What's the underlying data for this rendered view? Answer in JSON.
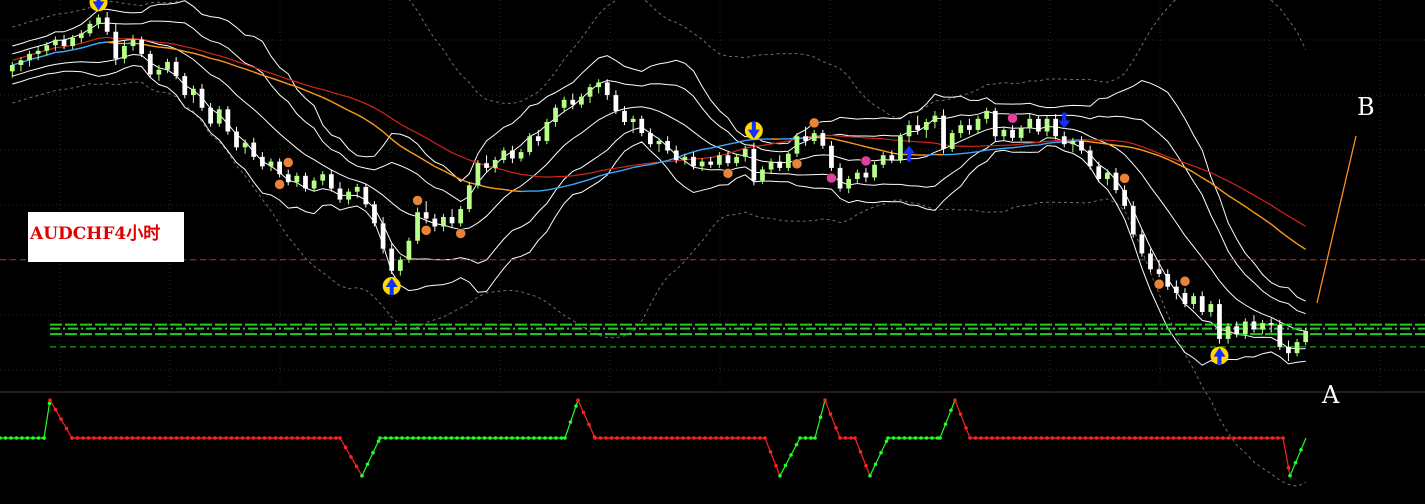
{
  "label": "AUDCHF4小时",
  "annotations": {
    "a": "A",
    "b": "B"
  },
  "colors": {
    "background": "#000000",
    "grid": "#26301f",
    "candle_bull": "#b8ff8a",
    "candle_bear": "#ffffff",
    "band": "#ffffff",
    "outer_band": "#6e6e6e",
    "ma_cyan": "#3aa8ff",
    "ma_orange": "#ff9a1a",
    "ma_red": "#d2261a",
    "support_line": "#22cc22",
    "resistance_line": "#cc2a2a",
    "trend_line": "#ff8c1a",
    "ind_up": "#22ff22",
    "ind_down": "#ff2222"
  },
  "chart_data": {
    "type": "candlestick",
    "symbol": "AUDCHF",
    "timeframe": "H4",
    "y_range": [
      0.73,
      0.778
    ],
    "ohlc": [
      [
        0.77,
        0.7712,
        0.7692,
        0.7708
      ],
      [
        0.7708,
        0.7718,
        0.77,
        0.7714
      ],
      [
        0.7714,
        0.7726,
        0.7706,
        0.7722
      ],
      [
        0.7722,
        0.7731,
        0.7714,
        0.7726
      ],
      [
        0.7726,
        0.7737,
        0.772,
        0.7733
      ],
      [
        0.7733,
        0.7744,
        0.7726,
        0.774
      ],
      [
        0.774,
        0.7746,
        0.7728,
        0.7732
      ],
      [
        0.7732,
        0.7746,
        0.7728,
        0.7742
      ],
      [
        0.7742,
        0.7752,
        0.7736,
        0.7748
      ],
      [
        0.7748,
        0.7764,
        0.7744,
        0.776
      ],
      [
        0.776,
        0.7772,
        0.7754,
        0.7768
      ],
      [
        0.7768,
        0.7775,
        0.7746,
        0.775
      ],
      [
        0.775,
        0.776,
        0.7708,
        0.7716
      ],
      [
        0.7716,
        0.7738,
        0.771,
        0.7732
      ],
      [
        0.7732,
        0.7746,
        0.7726,
        0.774
      ],
      [
        0.774,
        0.7744,
        0.7718,
        0.7722
      ],
      [
        0.7722,
        0.7726,
        0.7692,
        0.7696
      ],
      [
        0.7696,
        0.7708,
        0.7688,
        0.7702
      ],
      [
        0.7702,
        0.7716,
        0.7698,
        0.7712
      ],
      [
        0.7712,
        0.7718,
        0.769,
        0.7694
      ],
      [
        0.7694,
        0.7698,
        0.7666,
        0.767
      ],
      [
        0.767,
        0.7682,
        0.766,
        0.7678
      ],
      [
        0.7678,
        0.7684,
        0.765,
        0.7654
      ],
      [
        0.7654,
        0.766,
        0.763,
        0.7634
      ],
      [
        0.7634,
        0.7656,
        0.763,
        0.7652
      ],
      [
        0.7652,
        0.7656,
        0.762,
        0.7624
      ],
      [
        0.7624,
        0.763,
        0.76,
        0.7604
      ],
      [
        0.7604,
        0.7614,
        0.7596,
        0.761
      ],
      [
        0.761,
        0.7616,
        0.7588,
        0.7592
      ],
      [
        0.7592,
        0.7598,
        0.7576,
        0.758
      ],
      [
        0.758,
        0.759,
        0.7574,
        0.7586
      ],
      [
        0.7586,
        0.759,
        0.7566,
        0.757
      ],
      [
        0.757,
        0.7576,
        0.7556,
        0.756
      ],
      [
        0.756,
        0.7572,
        0.7554,
        0.7568
      ],
      [
        0.7568,
        0.7572,
        0.7548,
        0.7552
      ],
      [
        0.7552,
        0.7566,
        0.7548,
        0.7562
      ],
      [
        0.7562,
        0.7574,
        0.7556,
        0.757
      ],
      [
        0.757,
        0.7576,
        0.7548,
        0.7552
      ],
      [
        0.7552,
        0.756,
        0.7534,
        0.7538
      ],
      [
        0.7538,
        0.7552,
        0.7532,
        0.7548
      ],
      [
        0.7548,
        0.7558,
        0.754,
        0.7554
      ],
      [
        0.7554,
        0.7558,
        0.7528,
        0.7532
      ],
      [
        0.7532,
        0.7536,
        0.7504,
        0.7508
      ],
      [
        0.7508,
        0.7516,
        0.747,
        0.7476
      ],
      [
        0.7476,
        0.7482,
        0.7444,
        0.7448
      ],
      [
        0.7448,
        0.7466,
        0.7442,
        0.7462
      ],
      [
        0.7462,
        0.749,
        0.7458,
        0.7486
      ],
      [
        0.7486,
        0.7528,
        0.7482,
        0.7522
      ],
      [
        0.7522,
        0.7536,
        0.7508,
        0.7514
      ],
      [
        0.7514,
        0.752,
        0.7498,
        0.7504
      ],
      [
        0.7504,
        0.752,
        0.7498,
        0.7516
      ],
      [
        0.7516,
        0.7526,
        0.7502,
        0.7508
      ],
      [
        0.7508,
        0.753,
        0.7504,
        0.7526
      ],
      [
        0.7526,
        0.756,
        0.7522,
        0.7556
      ],
      [
        0.7556,
        0.7588,
        0.7552,
        0.7584
      ],
      [
        0.7584,
        0.7594,
        0.7572,
        0.7578
      ],
      [
        0.7578,
        0.7592,
        0.7572,
        0.7588
      ],
      [
        0.7588,
        0.7604,
        0.7584,
        0.76
      ],
      [
        0.76,
        0.7606,
        0.7584,
        0.759
      ],
      [
        0.759,
        0.7602,
        0.7586,
        0.7598
      ],
      [
        0.7598,
        0.7622,
        0.7594,
        0.7618
      ],
      [
        0.7618,
        0.7626,
        0.7606,
        0.7612
      ],
      [
        0.7612,
        0.764,
        0.7608,
        0.7636
      ],
      [
        0.7636,
        0.7658,
        0.763,
        0.7654
      ],
      [
        0.7654,
        0.7668,
        0.7648,
        0.7664
      ],
      [
        0.7664,
        0.7672,
        0.7652,
        0.7658
      ],
      [
        0.7658,
        0.7672,
        0.7654,
        0.7668
      ],
      [
        0.7668,
        0.7684,
        0.766,
        0.768
      ],
      [
        0.768,
        0.769,
        0.7672,
        0.7686
      ],
      [
        0.7686,
        0.769,
        0.7664,
        0.767
      ],
      [
        0.767,
        0.7676,
        0.7646,
        0.765
      ],
      [
        0.765,
        0.7656,
        0.7632,
        0.7636
      ],
      [
        0.7636,
        0.7644,
        0.7622,
        0.764
      ],
      [
        0.764,
        0.7644,
        0.7618,
        0.7622
      ],
      [
        0.7622,
        0.7628,
        0.7604,
        0.7608
      ],
      [
        0.7608,
        0.7616,
        0.7598,
        0.7612
      ],
      [
        0.7612,
        0.7618,
        0.7596,
        0.76
      ],
      [
        0.76,
        0.7606,
        0.7584,
        0.7588
      ],
      [
        0.7588,
        0.7596,
        0.7582,
        0.7592
      ],
      [
        0.7592,
        0.7598,
        0.7576,
        0.758
      ],
      [
        0.758,
        0.759,
        0.7574,
        0.7586
      ],
      [
        0.7586,
        0.7592,
        0.7578,
        0.7582
      ],
      [
        0.7582,
        0.7598,
        0.7578,
        0.7594
      ],
      [
        0.7594,
        0.7598,
        0.758,
        0.7584
      ],
      [
        0.7584,
        0.7596,
        0.758,
        0.7592
      ],
      [
        0.7592,
        0.7606,
        0.7586,
        0.7602
      ],
      [
        0.7602,
        0.761,
        0.7556,
        0.7562
      ],
      [
        0.7562,
        0.758,
        0.7558,
        0.7576
      ],
      [
        0.7576,
        0.759,
        0.757,
        0.7586
      ],
      [
        0.7586,
        0.7594,
        0.7574,
        0.7578
      ],
      [
        0.7578,
        0.7598,
        0.7574,
        0.7596
      ],
      [
        0.7596,
        0.7622,
        0.7592,
        0.7618
      ],
      [
        0.7618,
        0.763,
        0.7606,
        0.7612
      ],
      [
        0.7612,
        0.7626,
        0.7608,
        0.7622
      ],
      [
        0.7622,
        0.7626,
        0.7602,
        0.7606
      ],
      [
        0.7606,
        0.7612,
        0.7574,
        0.7578
      ],
      [
        0.7578,
        0.7584,
        0.7548,
        0.7552
      ],
      [
        0.7552,
        0.7568,
        0.7546,
        0.7564
      ],
      [
        0.7564,
        0.7576,
        0.7558,
        0.7572
      ],
      [
        0.7572,
        0.7578,
        0.756,
        0.7566
      ],
      [
        0.7566,
        0.7586,
        0.7562,
        0.7582
      ],
      [
        0.7582,
        0.7598,
        0.7578,
        0.7594
      ],
      [
        0.7594,
        0.76,
        0.7584,
        0.7588
      ],
      [
        0.7588,
        0.7622,
        0.7584,
        0.7618
      ],
      [
        0.7618,
        0.7638,
        0.761,
        0.7632
      ],
      [
        0.7632,
        0.7644,
        0.762,
        0.7626
      ],
      [
        0.7626,
        0.764,
        0.7616,
        0.7636
      ],
      [
        0.7636,
        0.765,
        0.7628,
        0.7644
      ],
      [
        0.7644,
        0.7652,
        0.7596,
        0.7602
      ],
      [
        0.7602,
        0.7626,
        0.7598,
        0.7622
      ],
      [
        0.7622,
        0.7638,
        0.7616,
        0.7632
      ],
      [
        0.7632,
        0.764,
        0.762,
        0.7626
      ],
      [
        0.7626,
        0.7644,
        0.7622,
        0.764
      ],
      [
        0.764,
        0.7654,
        0.7634,
        0.765
      ],
      [
        0.765,
        0.7654,
        0.7612,
        0.7618
      ],
      [
        0.7618,
        0.763,
        0.7612,
        0.7626
      ],
      [
        0.7626,
        0.7632,
        0.7612,
        0.7616
      ],
      [
        0.7616,
        0.7632,
        0.7612,
        0.7628
      ],
      [
        0.7628,
        0.7646,
        0.7622,
        0.764
      ],
      [
        0.764,
        0.7644,
        0.762,
        0.7624
      ],
      [
        0.7624,
        0.7644,
        0.7618,
        0.764
      ],
      [
        0.764,
        0.7646,
        0.7614,
        0.7618
      ],
      [
        0.7618,
        0.7624,
        0.7604,
        0.7608
      ],
      [
        0.7608,
        0.7616,
        0.7598,
        0.7612
      ],
      [
        0.7612,
        0.7618,
        0.7596,
        0.76
      ],
      [
        0.76,
        0.7606,
        0.7576,
        0.758
      ],
      [
        0.758,
        0.7586,
        0.756,
        0.7564
      ],
      [
        0.7564,
        0.7576,
        0.7556,
        0.7572
      ],
      [
        0.7572,
        0.7578,
        0.7546,
        0.755
      ],
      [
        0.755,
        0.7556,
        0.7526,
        0.753
      ],
      [
        0.753,
        0.7536,
        0.749,
        0.7494
      ],
      [
        0.7494,
        0.75,
        0.7466,
        0.747
      ],
      [
        0.747,
        0.7476,
        0.7446,
        0.745
      ],
      [
        0.745,
        0.7462,
        0.744,
        0.7444
      ],
      [
        0.7444,
        0.745,
        0.7424,
        0.7428
      ],
      [
        0.7428,
        0.7436,
        0.7412,
        0.742
      ],
      [
        0.742,
        0.7426,
        0.7402,
        0.7406
      ],
      [
        0.7406,
        0.742,
        0.74,
        0.7416
      ],
      [
        0.7416,
        0.7422,
        0.7392,
        0.7396
      ],
      [
        0.7396,
        0.741,
        0.739,
        0.7406
      ],
      [
        0.7406,
        0.7412,
        0.7356,
        0.7362
      ],
      [
        0.7362,
        0.7382,
        0.7356,
        0.7378
      ],
      [
        0.7378,
        0.7384,
        0.7364,
        0.7368
      ],
      [
        0.7368,
        0.7388,
        0.7362,
        0.7384
      ],
      [
        0.7384,
        0.7392,
        0.737,
        0.7374
      ],
      [
        0.7374,
        0.7386,
        0.7368,
        0.7382
      ],
      [
        0.7382,
        0.7388,
        0.737,
        0.738
      ],
      [
        0.738,
        0.7386,
        0.7348,
        0.7352
      ],
      [
        0.7352,
        0.736,
        0.7334,
        0.7344
      ],
      [
        0.7344,
        0.7362,
        0.734,
        0.7358
      ],
      [
        0.7358,
        0.7376,
        0.7354,
        0.7372
      ]
    ],
    "lines": {
      "resistance": 0.7462,
      "support": [
        0.738,
        0.7375,
        0.7368,
        0.7352
      ]
    },
    "indicator_levels": {
      "high": 95,
      "mid": 50,
      "low": 5
    }
  }
}
